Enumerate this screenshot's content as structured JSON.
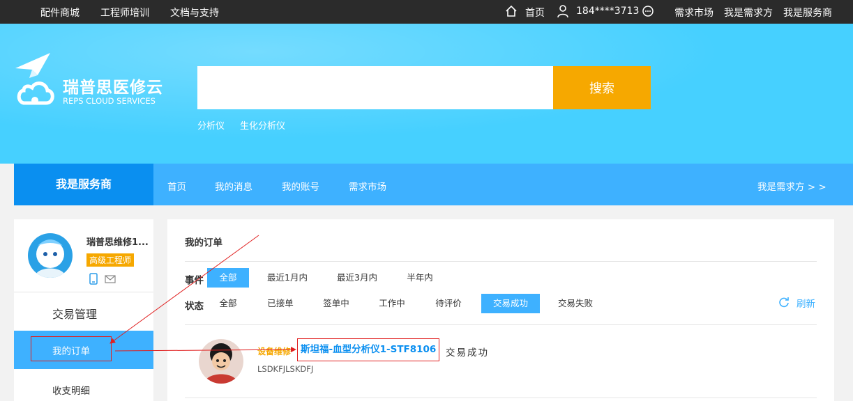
{
  "topbar": {
    "left_links": [
      "配件商城",
      "工程师培训",
      "文档与支持"
    ],
    "home": "首页",
    "user_phone": "184****3713",
    "right_links": [
      "需求市场",
      "我是需求方",
      "我是服务商"
    ]
  },
  "logo": {
    "cn": "瑞普思医修云",
    "en": "REPS CLOUD SERVICES"
  },
  "search": {
    "value": "",
    "button_label": "搜索",
    "hot_keywords": [
      "分析仪",
      "生化分析仪"
    ]
  },
  "nav": {
    "brand": "我是服务商",
    "items": [
      "首页",
      "我的消息",
      "我的账号",
      "需求市场"
    ],
    "switch_role": "我是需求方 > >"
  },
  "sidebar": {
    "user_name": "瑞普思维修1...",
    "badge": "高级工程师",
    "section_title": "交易管理",
    "items": [
      "我的订单",
      "收支明细"
    ]
  },
  "main": {
    "title": "我的订单",
    "event_label": "事件",
    "event_options": [
      "全部",
      "最近1月内",
      "最近3月内",
      "半年内"
    ],
    "event_selected": "全部",
    "status_label": "状态",
    "status_options": [
      "全部",
      "已接单",
      "签单中",
      "工作中",
      "待评价",
      "交易成功",
      "交易失败"
    ],
    "status_selected": "交易成功",
    "refresh_label": "刷新",
    "orders": [
      {
        "type": "设备维修",
        "title": "斯坦福-血型分析仪1-STF8106",
        "status": "交易成功",
        "code": "LSDKFJLSKDFJ"
      }
    ]
  },
  "colors": {
    "topbar_bg": "#2b2b2b",
    "hero_bg": "#46d0ff",
    "primary_blue": "#3eb1ff",
    "brand_blue": "#0a8ff0",
    "accent_orange": "#f6a800",
    "annotation_red": "#e02020"
  }
}
